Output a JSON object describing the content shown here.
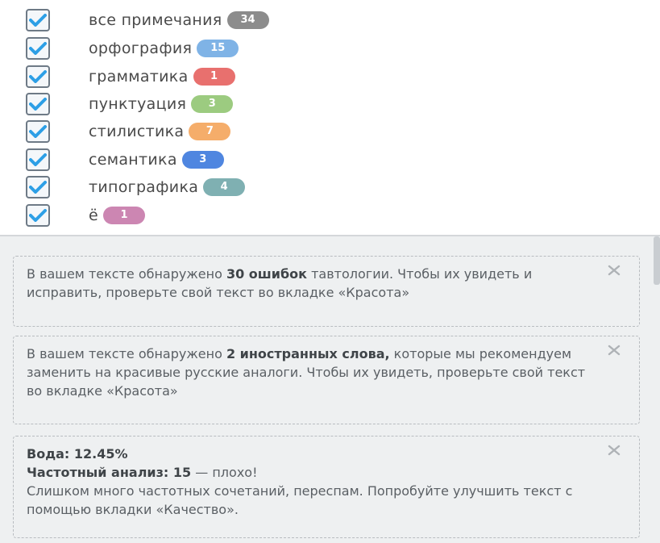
{
  "filters": [
    {
      "label": "все примечания",
      "count": "34",
      "color": "#8c8c8c",
      "checked": true
    },
    {
      "label": "орфография",
      "count": "15",
      "color": "#7fb3e6",
      "checked": true
    },
    {
      "label": "грамматика",
      "count": "1",
      "color": "#e8706e",
      "checked": true
    },
    {
      "label": "пунктуация",
      "count": "3",
      "color": "#9ccb80",
      "checked": true
    },
    {
      "label": "стилистика",
      "count": "7",
      "color": "#f5ad6a",
      "checked": true
    },
    {
      "label": "семантика",
      "count": "3",
      "color": "#4f86e0",
      "checked": true
    },
    {
      "label": "типографика",
      "count": "4",
      "color": "#7fb0b2",
      "checked": true
    },
    {
      "label": "ё",
      "count": "1",
      "color": "#cc86b2",
      "checked": true
    }
  ],
  "notices": [
    {
      "prefix": "В вашем тексте обнаружено ",
      "bold": "30 ошибок",
      "suffix": " тавтологии. Чтобы их увидеть и исправить, проверьте свой текст во вкладке «Красота»"
    },
    {
      "prefix": "В вашем тексте обнаружено ",
      "bold": "2 иностранных слова,",
      "suffix": " которые мы рекомендуем заменить на красивые русские аналоги. Чтобы их увидеть, проверьте свой текст во вкладке «Красота»"
    },
    {
      "water_label": "Вода: 12.45%",
      "freq_label": "Частотный анализ: 15",
      "freq_suffix": " — плохо!",
      "body": "Слишком много частотных сочетаний, переспам. Попробуйте улучшить текст с помощью вкладки «Качество»."
    }
  ],
  "icons": {
    "checkbox": "checkmark-icon",
    "close": "close-icon"
  },
  "colors": {
    "check": "#2d9fe6",
    "text": "#4a4a4a",
    "notice_bg": "#eef0f1"
  }
}
